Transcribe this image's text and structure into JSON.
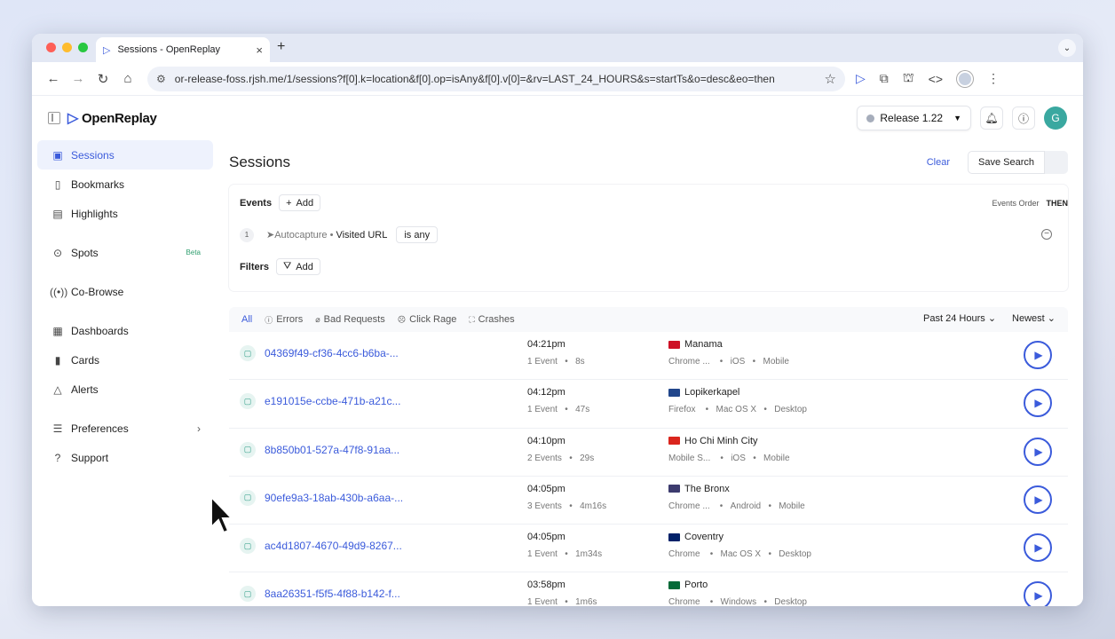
{
  "browser": {
    "tab_title": "Sessions - OpenReplay",
    "new_tab": "+",
    "url": "or-release-foss.rjsh.me/1/sessions?f[0].k=location&f[0].op=isAny&f[0].v[0]=&rv=LAST_24_HOURS&s=startTs&o=desc&eo=then"
  },
  "header": {
    "logo_text": "OpenReplay",
    "release_label": "Release 1.22",
    "avatar_initial": "G"
  },
  "sidebar": {
    "items": [
      {
        "label": "Sessions"
      },
      {
        "label": "Bookmarks"
      },
      {
        "label": "Highlights"
      },
      {
        "label": "Spots",
        "badge": "Beta"
      },
      {
        "label": "Co-Browse"
      },
      {
        "label": "Dashboards"
      },
      {
        "label": "Cards"
      },
      {
        "label": "Alerts"
      },
      {
        "label": "Preferences"
      },
      {
        "label": "Support"
      }
    ]
  },
  "main": {
    "title": "Sessions",
    "clear_label": "Clear",
    "save_search_label": "Save Search",
    "events_label": "Events",
    "add_label": "Add",
    "events_order_label": "Events Order",
    "events_order_value": "THEN",
    "event_step": "1",
    "event_source": "Autocapture",
    "event_name": "Visited URL",
    "event_operator": "is any",
    "filters_label": "Filters",
    "filters_add_label": "Add"
  },
  "list": {
    "tabs": [
      "All",
      "Errors",
      "Bad Requests",
      "Click Rage",
      "Crashes"
    ],
    "time_range": "Past 24 Hours",
    "sort": "Newest",
    "rows": [
      {
        "id": "04369f49-cf36-4cc6-b6ba-...",
        "time": "04:21pm",
        "events": "1 Event",
        "duration": "8s",
        "city": "Manama",
        "browser": "Chrome ...",
        "os": "iOS",
        "device": "Mobile",
        "flag_color": "#ce1126"
      },
      {
        "id": "e191015e-ccbe-471b-a21c...",
        "time": "04:12pm",
        "events": "1 Event",
        "duration": "47s",
        "city": "Lopikerkapel",
        "browser": "Firefox",
        "os": "Mac OS X",
        "device": "Desktop",
        "flag_color": "#21468b"
      },
      {
        "id": "8b850b01-527a-47f8-91aa...",
        "time": "04:10pm",
        "events": "2 Events",
        "duration": "29s",
        "city": "Ho Chi Minh City",
        "browser": "Mobile S...",
        "os": "iOS",
        "device": "Mobile",
        "flag_color": "#da251d"
      },
      {
        "id": "90efe9a3-18ab-430b-a6aa-...",
        "time": "04:05pm",
        "events": "3 Events",
        "duration": "4m16s",
        "city": "The Bronx",
        "browser": "Chrome ...",
        "os": "Android",
        "device": "Mobile",
        "flag_color": "#3c3b6e"
      },
      {
        "id": "ac4d1807-4670-49d9-8267...",
        "time": "04:05pm",
        "events": "1 Event",
        "duration": "1m34s",
        "city": "Coventry",
        "browser": "Chrome",
        "os": "Mac OS X",
        "device": "Desktop",
        "flag_color": "#012169"
      },
      {
        "id": "8aa26351-f5f5-4f88-b142-f...",
        "time": "03:58pm",
        "events": "1 Event",
        "duration": "1m6s",
        "city": "Porto",
        "browser": "Chrome",
        "os": "Windows",
        "device": "Desktop",
        "flag_color": "#046a38"
      }
    ]
  },
  "colors": {
    "accent": "#3b5bdb",
    "teal": "#2e9c86"
  }
}
